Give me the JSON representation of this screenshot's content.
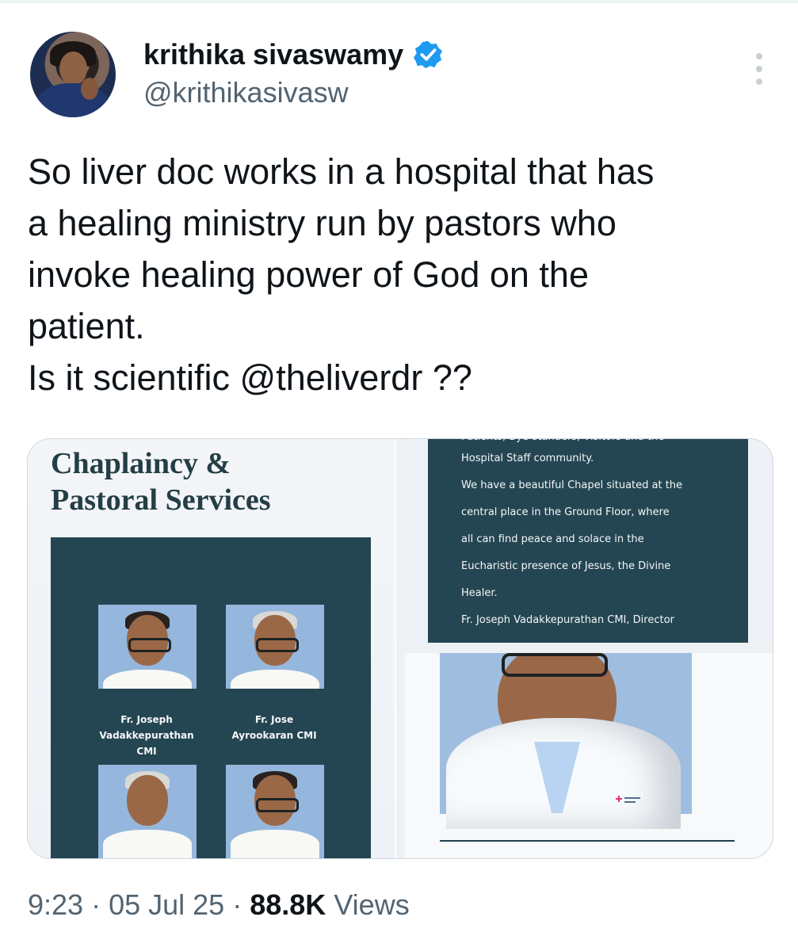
{
  "account": {
    "name": "krithika sivaswamy",
    "handle": "@krithikasivasw"
  },
  "tweet": {
    "lines": [
      "So liver doc works in a hospital that has",
      "a healing ministry run by pastors who",
      "invoke healing power of God on the",
      "patient.",
      "Is it scientific @theliverdr ??"
    ]
  },
  "media": {
    "left": {
      "title_lines": [
        "Chaplaincy &",
        "Pastoral Services"
      ],
      "captions": [
        {
          "lines": [
            "Fr. Joseph",
            "Vadakkepurathan",
            "CMI"
          ]
        },
        {
          "lines": [
            "Fr. Jose",
            "Ayrookaran CMI"
          ]
        }
      ]
    },
    "right_top": {
      "cut_text": "Patients, Bye-standers, Visitors and the",
      "lines": [
        "Hospital Staff community.",
        "We have a beautiful Chapel situated at the",
        "central place in the Ground Floor, where",
        "all can find peace and solace in the",
        "Eucharistic presence of Jesus, the Divine",
        "Healer.",
        "Fr. Joseph Vadakkepurathan CMI, Director"
      ]
    },
    "right_bottom": {
      "image_description_label": ""
    }
  },
  "footer": {
    "time": "9:23",
    "date": "05 Jul 25",
    "views_count": "88.8K",
    "views_label": "Views"
  },
  "icons": {
    "verified": "verified-badge-icon",
    "more": "more-options-icon"
  },
  "colors": {
    "accent": "#1d9bf0",
    "muted": "#536471",
    "teal_panel": "#244652"
  }
}
